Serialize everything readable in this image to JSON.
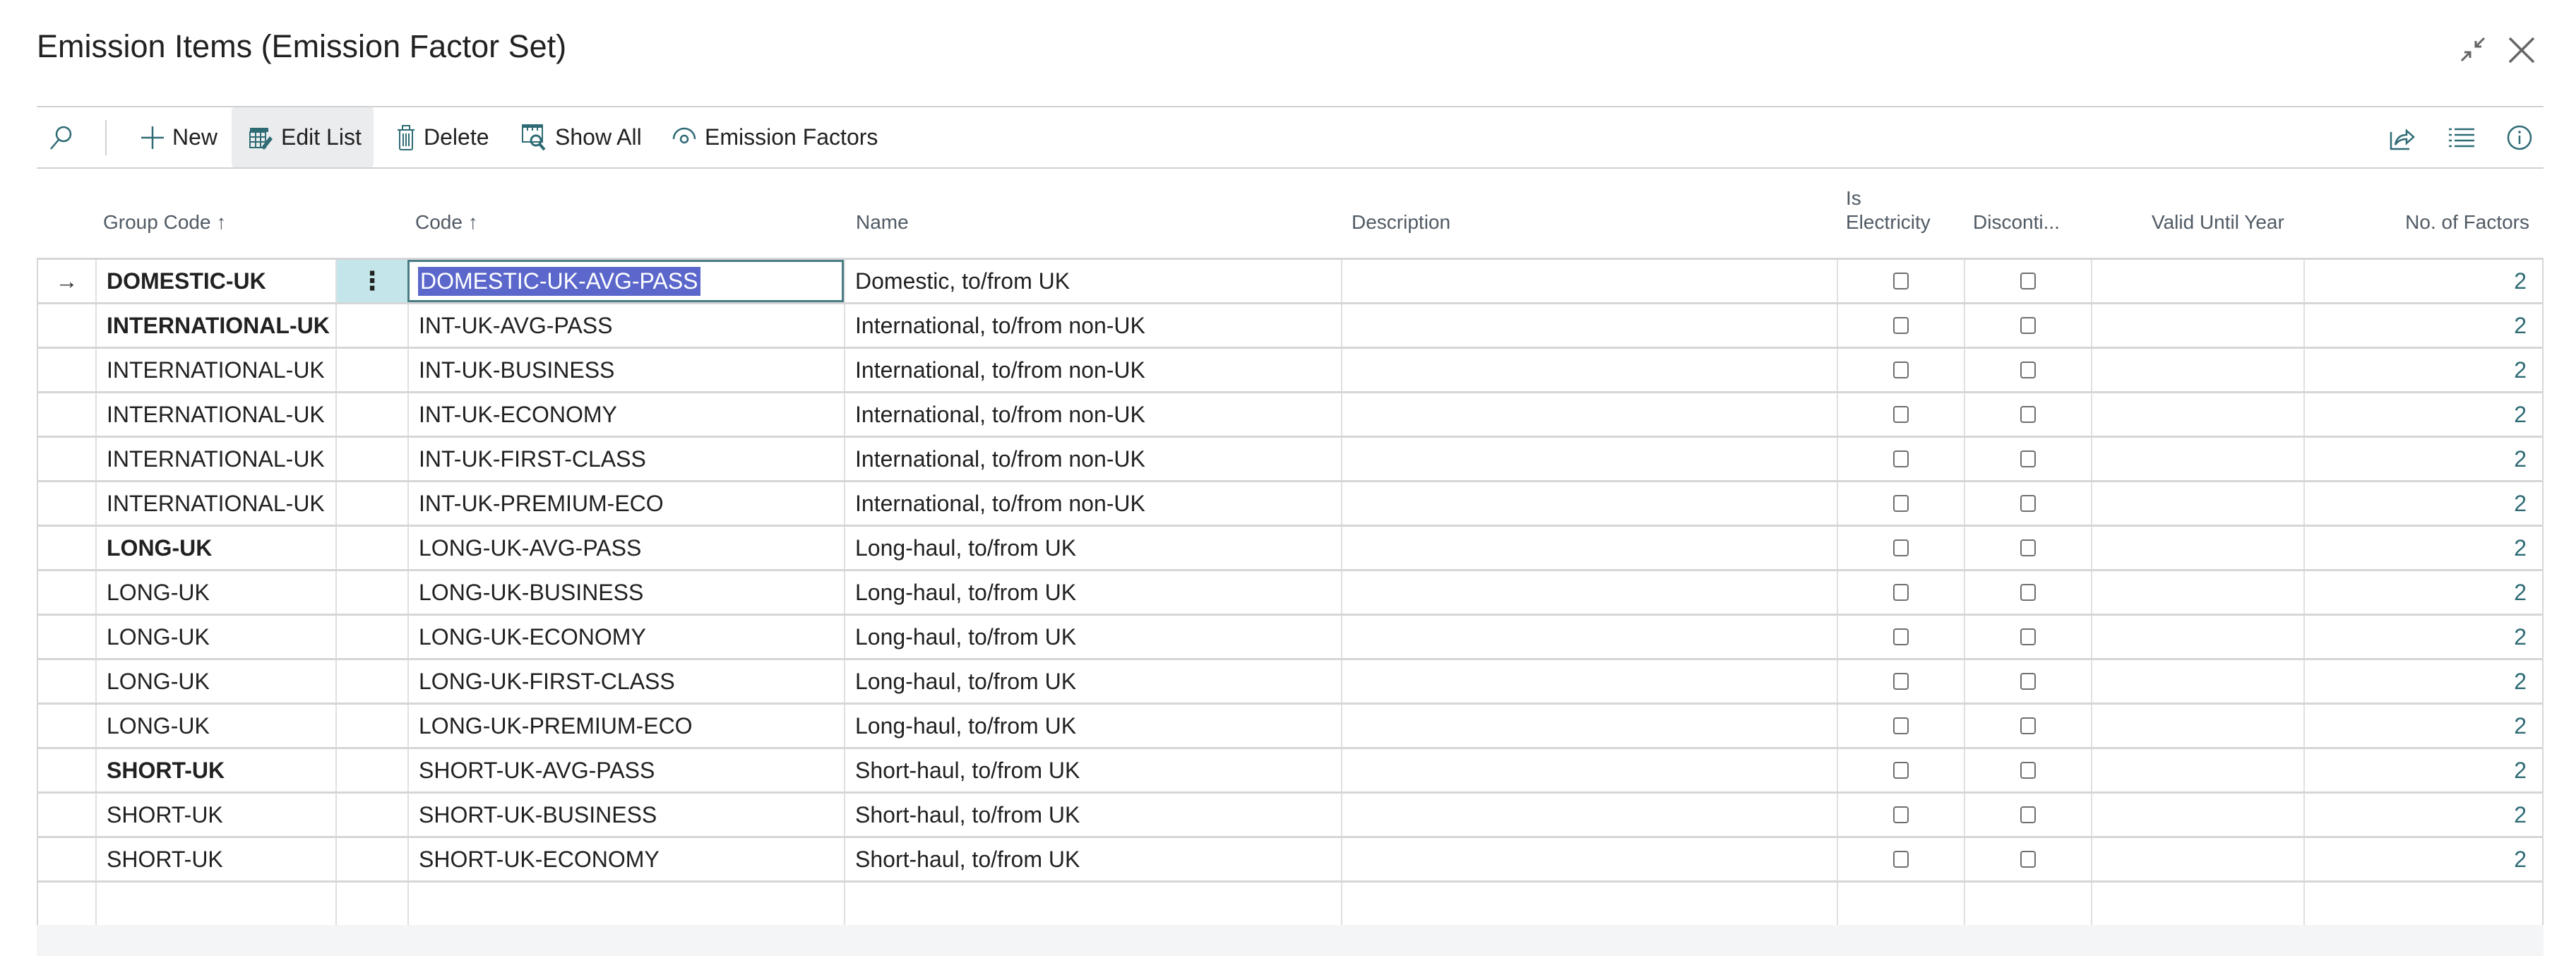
{
  "window": {
    "title": "Emission Items (Emission Factor Set)",
    "collapse_icon": "collapse-arrows-icon",
    "close_icon": "close-icon"
  },
  "toolbar": {
    "search_icon": "search-icon",
    "items": [
      {
        "label": "New",
        "icon": "plus-icon"
      },
      {
        "label": "Edit List",
        "icon": "edit-list-icon",
        "active": true
      },
      {
        "label": "Delete",
        "icon": "trash-icon"
      },
      {
        "label": "Show All",
        "icon": "show-all-icon"
      },
      {
        "label": "Emission Factors",
        "icon": "emission-factors-icon"
      }
    ],
    "right_icons": [
      "share-icon",
      "list-view-icon",
      "info-icon"
    ]
  },
  "columns": {
    "group_code": "Group Code",
    "group_code_sort": "↑",
    "code": "Code",
    "code_sort": "↑",
    "name": "Name",
    "description": "Description",
    "is_electricity_line1": "Is",
    "is_electricity_line2": "Electricity",
    "discontinued": "Disconti...",
    "valid_until_year": "Valid Until Year",
    "no_of_factors": "No. of Factors"
  },
  "rows": [
    {
      "group_code": "DOMESTIC-UK",
      "group_bold": true,
      "code": "DOMESTIC-UK-AVG-PASS",
      "name": "Domestic, to/from UK",
      "description": "",
      "is_electricity": false,
      "discontinued": false,
      "valid_until_year": "",
      "no_of_factors": "2",
      "selected": true
    },
    {
      "group_code": "INTERNATIONAL-UK",
      "group_bold": true,
      "code": "INT-UK-AVG-PASS",
      "name": "International, to/from non-UK",
      "description": "",
      "is_electricity": false,
      "discontinued": false,
      "valid_until_year": "",
      "no_of_factors": "2"
    },
    {
      "group_code": "INTERNATIONAL-UK",
      "group_bold": false,
      "code": "INT-UK-BUSINESS",
      "name": "International, to/from non-UK",
      "description": "",
      "is_electricity": false,
      "discontinued": false,
      "valid_until_year": "",
      "no_of_factors": "2"
    },
    {
      "group_code": "INTERNATIONAL-UK",
      "group_bold": false,
      "code": "INT-UK-ECONOMY",
      "name": "International, to/from non-UK",
      "description": "",
      "is_electricity": false,
      "discontinued": false,
      "valid_until_year": "",
      "no_of_factors": "2"
    },
    {
      "group_code": "INTERNATIONAL-UK",
      "group_bold": false,
      "code": "INT-UK-FIRST-CLASS",
      "name": "International, to/from non-UK",
      "description": "",
      "is_electricity": false,
      "discontinued": false,
      "valid_until_year": "",
      "no_of_factors": "2"
    },
    {
      "group_code": "INTERNATIONAL-UK",
      "group_bold": false,
      "code": "INT-UK-PREMIUM-ECO",
      "name": "International, to/from non-UK",
      "description": "",
      "is_electricity": false,
      "discontinued": false,
      "valid_until_year": "",
      "no_of_factors": "2"
    },
    {
      "group_code": "LONG-UK",
      "group_bold": true,
      "code": "LONG-UK-AVG-PASS",
      "name": "Long-haul, to/from UK",
      "description": "",
      "is_electricity": false,
      "discontinued": false,
      "valid_until_year": "",
      "no_of_factors": "2"
    },
    {
      "group_code": "LONG-UK",
      "group_bold": false,
      "code": "LONG-UK-BUSINESS",
      "name": "Long-haul, to/from UK",
      "description": "",
      "is_electricity": false,
      "discontinued": false,
      "valid_until_year": "",
      "no_of_factors": "2"
    },
    {
      "group_code": "LONG-UK",
      "group_bold": false,
      "code": "LONG-UK-ECONOMY",
      "name": "Long-haul, to/from UK",
      "description": "",
      "is_electricity": false,
      "discontinued": false,
      "valid_until_year": "",
      "no_of_factors": "2"
    },
    {
      "group_code": "LONG-UK",
      "group_bold": false,
      "code": "LONG-UK-FIRST-CLASS",
      "name": "Long-haul, to/from UK",
      "description": "",
      "is_electricity": false,
      "discontinued": false,
      "valid_until_year": "",
      "no_of_factors": "2"
    },
    {
      "group_code": "LONG-UK",
      "group_bold": false,
      "code": "LONG-UK-PREMIUM-ECO",
      "name": "Long-haul, to/from UK",
      "description": "",
      "is_electricity": false,
      "discontinued": false,
      "valid_until_year": "",
      "no_of_factors": "2"
    },
    {
      "group_code": "SHORT-UK",
      "group_bold": true,
      "code": "SHORT-UK-AVG-PASS",
      "name": "Short-haul, to/from UK",
      "description": "",
      "is_electricity": false,
      "discontinued": false,
      "valid_until_year": "",
      "no_of_factors": "2"
    },
    {
      "group_code": "SHORT-UK",
      "group_bold": false,
      "code": "SHORT-UK-BUSINESS",
      "name": "Short-haul, to/from UK",
      "description": "",
      "is_electricity": false,
      "discontinued": false,
      "valid_until_year": "",
      "no_of_factors": "2"
    },
    {
      "group_code": "SHORT-UK",
      "group_bold": false,
      "code": "SHORT-UK-ECONOMY",
      "name": "Short-haul, to/from UK",
      "description": "",
      "is_electricity": false,
      "discontinued": false,
      "valid_until_year": "",
      "no_of_factors": "2"
    }
  ],
  "colors": {
    "accent": "#2e6b75",
    "selection_bg": "#5b67cb",
    "row_action_bg": "#c4e6ea",
    "toolbar_active_bg": "#ebecee"
  }
}
